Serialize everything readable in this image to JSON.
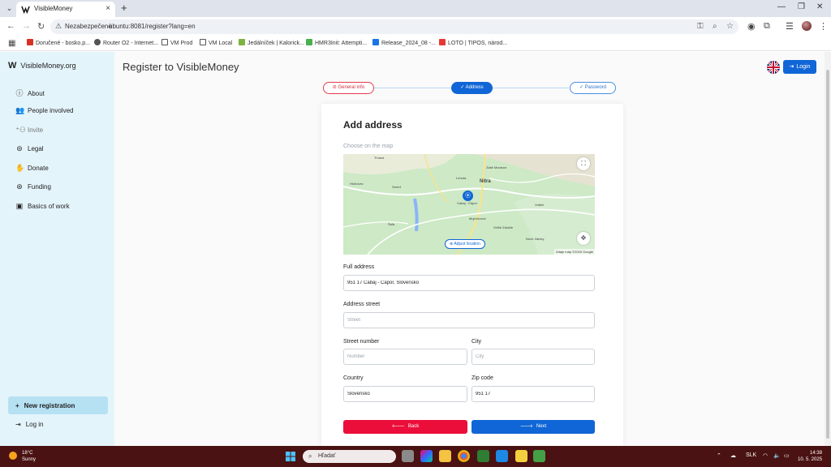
{
  "browser": {
    "tab_title": "VisibleMoney",
    "security_label": "Nezabezpečené",
    "url": "ubuntu:8081/register?lang=en",
    "bookmarks": [
      {
        "label": "Doručené - bosko.p...",
        "color": "#d93025"
      },
      {
        "label": "Router O2 - Internet...",
        "color": "#555555"
      },
      {
        "label": "VM Prod",
        "color": "#555555"
      },
      {
        "label": "VM Local",
        "color": "#555555"
      },
      {
        "label": "Jedálníček | Kalorick...",
        "color": "#7cb342"
      },
      {
        "label": "HMR3Init: Attempti...",
        "color": "#4caf50"
      },
      {
        "label": "Release_2024_08 -...",
        "color": "#1a73e8"
      },
      {
        "label": "LOTO | TIPOS, národ...",
        "color": "#e53935"
      }
    ]
  },
  "sidebar": {
    "brand": "VisibleMoney.org",
    "brand_logo": "W",
    "items": [
      {
        "label": "About",
        "icon": "info-icon"
      },
      {
        "label": "People involved",
        "icon": "people-icon"
      },
      {
        "label": "Invite",
        "icon": "invite-icon"
      },
      {
        "label": "Legal",
        "icon": "legal-icon"
      },
      {
        "label": "Donate",
        "icon": "donate-icon"
      },
      {
        "label": "Funding",
        "icon": "funding-icon"
      },
      {
        "label": "Basics of work",
        "icon": "briefcase-icon"
      }
    ],
    "new_registration": "New registration",
    "logout": "Log in"
  },
  "header": {
    "title": "Register to VisibleMoney",
    "login": "Login"
  },
  "steps": [
    {
      "label": "General info",
      "state": "error"
    },
    {
      "label": "Address",
      "state": "active"
    },
    {
      "label": "Password",
      "state": "pending"
    }
  ],
  "form": {
    "title": "Add address",
    "map_label": "Choose on the map",
    "adjust_location": "Adjust location",
    "map_credit": "Údaje máp ©2025 Google",
    "full_address": {
      "label": "Full address",
      "value": "951 17 Cabaj - Čápor, Slovensko"
    },
    "street": {
      "label": "Address street",
      "placeholder": "Street"
    },
    "street_number": {
      "label": "Street number",
      "placeholder": "Number"
    },
    "city": {
      "label": "City",
      "placeholder": "City"
    },
    "country": {
      "label": "Country",
      "value": "Slovensko"
    },
    "zip": {
      "label": "Zip code",
      "value": "951 17"
    },
    "back": "Back",
    "next": "Next"
  },
  "map_places": [
    "Trnava",
    "Zlaté Moravce",
    "Sereď",
    "Nitra",
    "Lehota",
    "Cabaj - Čápor",
    "Mojmírovce",
    "Vráble",
    "Veľké Zálužie",
    "Šaľa",
    "Nové Zámky",
    "Hlohovec"
  ],
  "taskbar": {
    "temperature": "18°C",
    "condition": "Sunny",
    "search": "Hľadať",
    "language": "SLK",
    "time": "14:38",
    "date": "10. 5. 2025"
  },
  "colors": {
    "primary": "#1066d6",
    "danger": "#ec0e3a",
    "sidebar_bg": "#e4f4fb",
    "taskbar_bg": "#4a1212"
  }
}
